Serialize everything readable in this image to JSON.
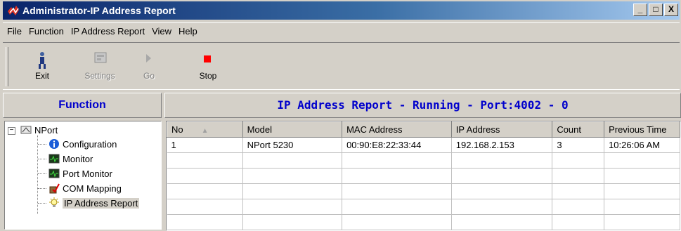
{
  "window": {
    "title": "Administrator-IP Address Report",
    "buttons": [
      "_",
      "□",
      "X"
    ]
  },
  "menu": [
    "File",
    "Function",
    "IP Address Report",
    "View",
    "Help"
  ],
  "toolbar": {
    "exit": "Exit",
    "settings": "Settings",
    "go": "Go",
    "stop": "Stop"
  },
  "function_panel": {
    "title": "Function",
    "root": "NPort",
    "items": [
      "Configuration",
      "Monitor",
      "Port Monitor",
      "COM Mapping",
      "IP Address Report"
    ]
  },
  "report": {
    "title": "IP Address Report - Running - Port:4002 - 0",
    "columns": [
      "No",
      "Model",
      "MAC Address",
      "IP Address",
      "Count",
      "Previous Time"
    ],
    "rows": [
      [
        "1",
        "NPort 5230",
        "00:90:E8:22:33:44",
        "192.168.2.153",
        "3",
        "10:26:06 AM"
      ]
    ]
  },
  "colors": {
    "title_gradient_start": "#0a246a",
    "panel_title": "#0000cc",
    "face": "#d4d0c8",
    "stop_red": "#ff0000"
  }
}
